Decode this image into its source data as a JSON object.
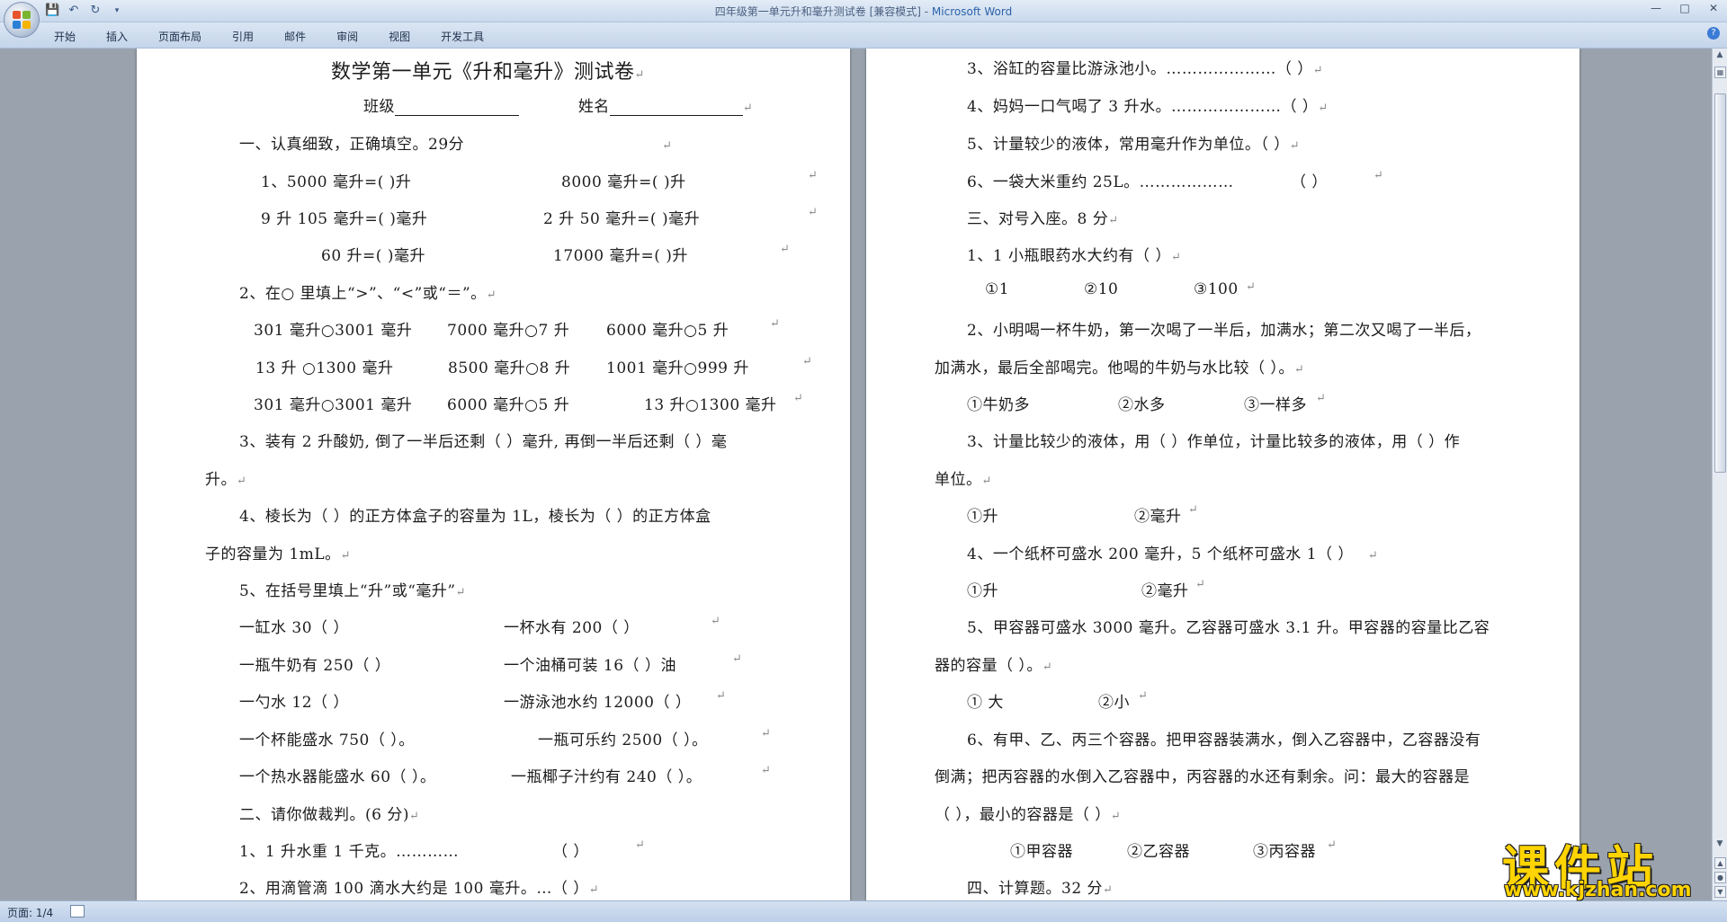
{
  "window": {
    "title": "四年级第一单元升和毫升测试卷 [兼容模式] - ",
    "app": "Microsoft Word"
  },
  "menu": [
    "开始",
    "插入",
    "页面布局",
    "引用",
    "邮件",
    "审阅",
    "视图",
    "开发工具"
  ],
  "status": {
    "page": "页面: 1/4"
  },
  "watermark": {
    "main": "课件站",
    "url": "www.kjzhan.com"
  },
  "page1": {
    "title": "数学第一单元《升和毫升》测试卷",
    "class_label": "班级",
    "name_label": "姓名",
    "s1_title": "一、认真细致，正确填空。29分",
    "q1a": "1、5000 毫升=(        )升",
    "q1b": "8000 毫升=(          )升",
    "q1c": "9 升 105 毫升=(        )毫升",
    "q1d": "2 升 50 毫升=(          )毫升",
    "q1e": "60 升=(        )毫升",
    "q1f": "17000 毫升=(          )升",
    "q2": "2、在○ 里填上“>”、“<”或“＝”。",
    "q2a": "301 毫升○3001 毫升",
    "q2b": "7000 毫升○7 升",
    "q2c": "6000 毫升○5 升",
    "q2d": "13 升    ○1300 毫升",
    "q2e": "8500 毫升○8 升",
    "q2f": "1001 毫升○999 升",
    "q2g": "301 毫升○3001 毫升",
    "q2h": "6000 毫升○5 升",
    "q2i": "13 升○1300 毫升",
    "q3a": "3、装有 2 升酸奶, 倒了一半后还剩（     ）毫升, 再倒一半后还剩（     ）毫",
    "q3b": "升。",
    "q4a": "4、棱长为（       ）的正方体盒子的容量为 1L，棱长为（       ）的正方体盒",
    "q4b": "子的容量为 1mL。",
    "q5": "5、在括号里填上“升”或“毫升”",
    "q5a": "一缸水 30（          ）",
    "q5b": "一杯水有 200（      ）",
    "q5c": "一瓶牛奶有 250（      ）",
    "q5d": "一个油桶可装 16（    ）油",
    "q5e": "一勺水 12（    ）",
    "q5f": "一游泳池水约 12000（      ）",
    "q5g": "一个杯能盛水 750（          ）。",
    "q5h": "一瓶可乐约 2500（          ）。",
    "q5i": "一个热水器能盛水 60（          ）。",
    "q5j": "一瓶椰子汁约有 240（          ）。",
    "s2_title": "二、请你做裁判。(6 分)",
    "j1": "1、1 升水重 1 千克。…………",
    "j1b": "（      ）",
    "j2": "2、用滴管滴 100 滴水大约是 100 毫升。…（    ）"
  },
  "page2": {
    "j3": "3、浴缸的容量比游泳池小。…………………（    ）",
    "j4": "4、妈妈一口气喝了 3 升水。…………………（    ）",
    "j5": "5、计量较少的液体，常用毫升作为单位。（    ）",
    "j6": "6、一袋大米重约 25L。………………",
    "j6b": "（      ）",
    "s3_title": "三、对号入座。8 分",
    "c1": "1、1 小瓶眼药水大约有（      ）",
    "c1a": "①1",
    "c1b": "②10",
    "c1c": "③100",
    "c2a": "2、小明喝一杯牛奶，第一次喝了一半后，加满水；第二次又喝了一半后，",
    "c2b": "加满水，最后全部喝完。他喝的牛奶与水比较（      ）。",
    "c2o1": "①牛奶多",
    "c2o2": "②水多",
    "c2o3": "③一样多",
    "c3a": "3、计量比较少的液体，用（    ）作单位，计量比较多的液体，用（    ）作",
    "c3b": "单位。",
    "c3o1": "①升",
    "c3o2": "②毫升",
    "c4": "4、一个纸杯可盛水 200 毫升，5 个纸杯可盛水 1（        ）",
    "c4o1": "①升",
    "c4o2": "②毫升",
    "c5a": "5、甲容器可盛水 3000 毫升。乙容器可盛水 3.1 升。甲容器的容量比乙容",
    "c5b": "器的容量（          ）。",
    "c5o1": "①    大",
    "c5o2": "②小",
    "c6a": "6、有甲、乙、丙三个容器。把甲容器装满水，倒入乙容器中，乙容器没有",
    "c6b": "倒满；把丙容器的水倒入乙容器中，丙容器的水还有剩余。问：最大的容器是",
    "c6c": "（      ），最小的容器是（          ）",
    "c6o1": "①甲容器",
    "c6o2": "②乙容器",
    "c6o3": "③丙容器",
    "s4_title": "四、计算题。32 分"
  }
}
